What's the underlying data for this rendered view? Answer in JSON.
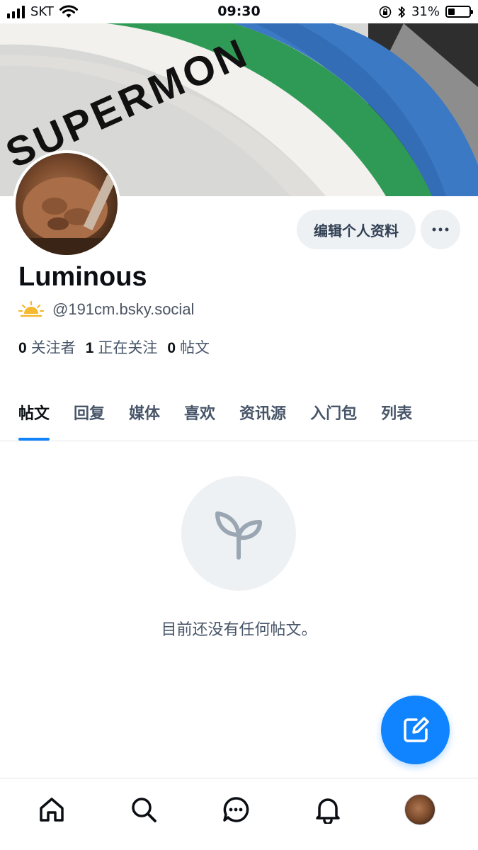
{
  "status_bar": {
    "carrier": "SKT",
    "time": "09:30",
    "battery_percent": "31%",
    "battery_level": 0.31,
    "icons": [
      "signal-icon",
      "wifi-icon",
      "orientation-lock-icon",
      "bluetooth-icon",
      "battery-icon"
    ]
  },
  "banner": {
    "image_text": "SUPERMON"
  },
  "profile": {
    "display_name": "Luminous",
    "handle": "@191cm.bsky.social",
    "handle_icon": "sunrise-icon",
    "edit_button_label": "编辑个人资料",
    "more_icon": "ellipsis-icon"
  },
  "stats": [
    {
      "count": "0",
      "label": "关注者"
    },
    {
      "count": "1",
      "label": "正在关注"
    },
    {
      "count": "0",
      "label": "帖文"
    }
  ],
  "tabs": [
    {
      "label": "帖文",
      "active": true
    },
    {
      "label": "回复"
    },
    {
      "label": "媒体"
    },
    {
      "label": "喜欢"
    },
    {
      "label": "资讯源"
    },
    {
      "label": "入门包"
    },
    {
      "label": "列表"
    }
  ],
  "empty_state": {
    "icon": "seedling-icon",
    "message": "目前还没有任何帖文。"
  },
  "fab": {
    "icon": "compose-icon"
  },
  "bottom_nav": [
    {
      "name": "home-icon"
    },
    {
      "name": "search-icon"
    },
    {
      "name": "chat-icon"
    },
    {
      "name": "bell-icon"
    },
    {
      "name": "profile-avatar"
    }
  ],
  "colors": {
    "accent": "#1083fe",
    "button_bg": "#eef1f4",
    "text_primary": "#0b0f14",
    "text_secondary": "#475569"
  }
}
